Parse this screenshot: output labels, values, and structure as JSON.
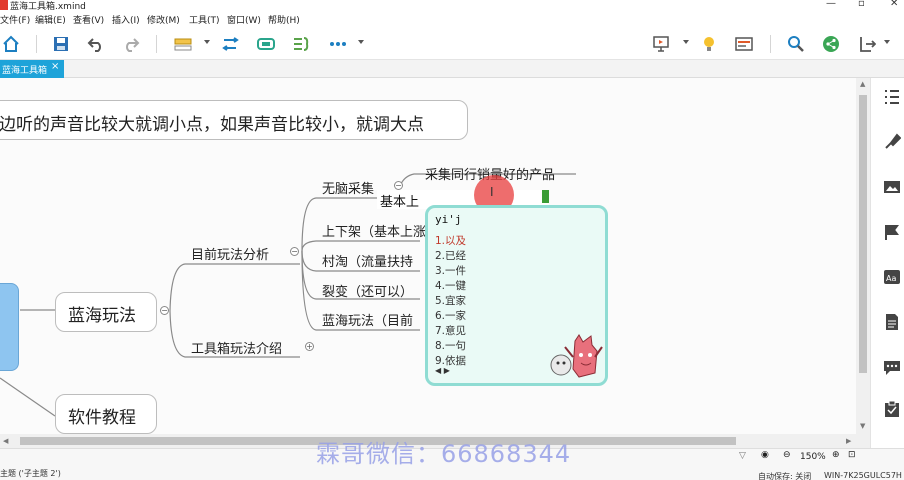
{
  "window": {
    "title": "蓝海工具箱.xmind",
    "controls": [
      "minimize-icon",
      "maximize-icon",
      "close-icon"
    ]
  },
  "menu": {
    "items": [
      "文件(F)",
      "编辑(E)",
      "查看(V)",
      "插入(I)",
      "修改(M)",
      "工具(T)",
      "窗口(W)",
      "帮助(H)"
    ]
  },
  "toolbar": {
    "left_icons": [
      "home-icon",
      "save-icon",
      "undo-icon",
      "redo-icon",
      "topic-style-icon",
      "relationship-icon",
      "boundary-icon",
      "summary-icon",
      "more-icon"
    ],
    "right_icons": [
      "presentation-icon",
      "idea-icon",
      "layout-icon",
      "search-icon",
      "share-icon",
      "export-icon"
    ]
  },
  "tab": {
    "label": "蓝海工具箱",
    "close": "×"
  },
  "mindmap": {
    "top_text": "边听的声音比较大就调小点，如果声音比较小，就调大点",
    "main_topics": {
      "blue_ocean": "蓝海玩法",
      "software_tutorial": "软件教程"
    },
    "branches": {
      "current_analysis": "目前玩法分析",
      "toolbox_intro": "工具箱玩法介绍"
    },
    "subtopics": {
      "mindless_collect": "无脑采集",
      "listing": "上下架（基本上涨",
      "village": "村淘（流量扶持",
      "fission": "裂变（还可以）",
      "blue_current": "蓝海玩法（目前"
    },
    "callout": "采集同行销量好的产品",
    "editing_text": "基本上",
    "collapse_symbol": "−",
    "expand_symbol": "+"
  },
  "ime": {
    "input": "yi'j",
    "candidates": [
      "1.以及",
      "2.已经",
      "3.一件",
      "4.一键",
      "5.宜家",
      "6.一家",
      "7.意见",
      "8.一句",
      "9.依据"
    ],
    "nav": "◀ ▶"
  },
  "status": {
    "left": "主题 ('子主题 2')",
    "zoom": "150%",
    "autosave": "自动保存: 关闭",
    "host": "WIN-7K25GULC57H"
  },
  "watermark": "霖哥微信：66868344",
  "colors": {
    "tab_active": "#1ea3d9",
    "ime_border": "#8fdcd3",
    "ime_bg": "#eafaf6",
    "highlight": "#e83c3c",
    "root_node": "#8ec5f0"
  }
}
